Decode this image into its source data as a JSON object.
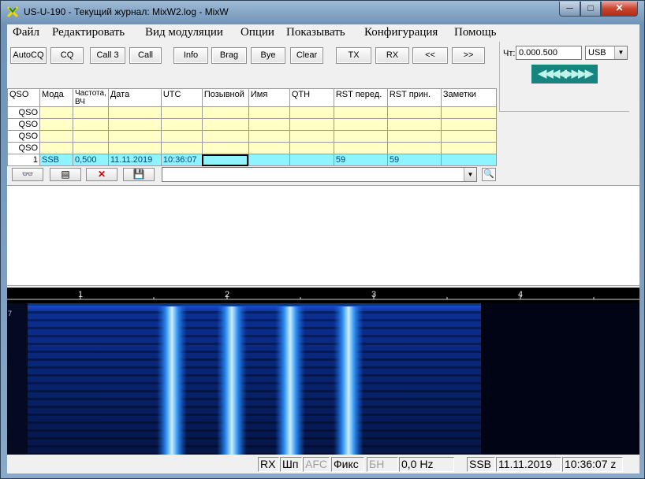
{
  "window": {
    "title": "US-U-190 - Текущий журнал: MixW2.log - MixW",
    "min_glyph": "─",
    "max_glyph": "□",
    "close_glyph": "✕"
  },
  "menu": {
    "items": [
      "Файл",
      "Редактировать",
      "Вид модуляции",
      "Опции",
      "Показывать",
      "Конфигурация",
      "Помощь"
    ]
  },
  "toolbar": {
    "buttons": [
      "AutoCQ",
      "CQ",
      "Call 3",
      "Call",
      "Info",
      "Brag",
      "Bye",
      "Clear",
      "TX",
      "RX",
      "<<",
      ">>"
    ]
  },
  "freq_panel": {
    "label": "Чт:",
    "frequency": "0.000.500",
    "mode": "USB",
    "tune_glyphs": "◀◀◀◀▶▶▶▶"
  },
  "log": {
    "headers": [
      "QSO",
      "Мода",
      "Частота, ВЧ",
      "Дата",
      "UTC",
      "Позывной",
      "Имя",
      "QTH",
      "RST перед.",
      "RST прин.",
      "Заметки"
    ],
    "empty_rows": [
      "QSO",
      "QSO",
      "QSO",
      "QSO"
    ],
    "current_row": [
      "1",
      "SSB",
      "0,500",
      "11.11.2019",
      "10:36:07",
      "",
      "",
      "",
      "59",
      "59",
      ""
    ]
  },
  "log_tools": {
    "icons": [
      "glasses-icon",
      "notebook-icon",
      "delete-icon",
      "save-icon"
    ],
    "delete_glyph": "✕",
    "save_glyph": "💾",
    "glasses_glyph": "👓",
    "notebook_glyph": "▤",
    "search_glyph": "🔍"
  },
  "waterfall": {
    "scale_labels": [
      "1",
      "2",
      "3",
      "4"
    ],
    "side_marker": "7"
  },
  "status": {
    "rx": "RX",
    "shp": "Шп",
    "afc": "AFC",
    "fix": "Фикс",
    "bn": "БН",
    "offset": "0,0 Hz",
    "mode": "SSB",
    "date": "11.11.2019",
    "time": "10:36:07 z"
  }
}
